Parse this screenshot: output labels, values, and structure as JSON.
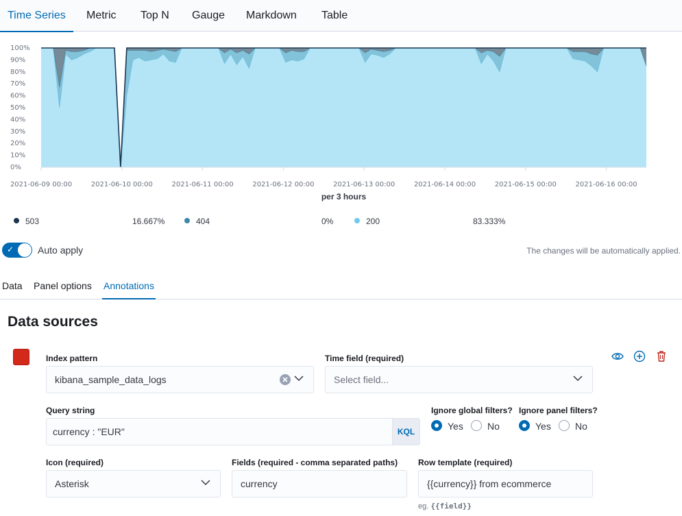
{
  "top_tabs": [
    "Time Series",
    "Metric",
    "Top N",
    "Gauge",
    "Markdown",
    "Table"
  ],
  "chart_data": {
    "type": "area",
    "stacked": true,
    "normalized_percent": true,
    "ylim": [
      0,
      100
    ],
    "y_ticks": [
      "100%",
      "90%",
      "80%",
      "70%",
      "60%",
      "50%",
      "40%",
      "30%",
      "20%",
      "10%",
      "0%"
    ],
    "x_ticks": [
      "2021-06-09 00:00",
      "2021-06-10 00:00",
      "2021-06-11 00:00",
      "2021-06-12 00:00",
      "2021-06-13 00:00",
      "2021-06-14 00:00",
      "2021-06-15 00:00",
      "2021-06-16 00:00"
    ],
    "xlabel": "per 3 hours",
    "x": [
      0,
      1,
      2,
      3,
      4,
      5,
      6,
      7,
      8,
      9,
      10,
      11,
      12,
      13,
      14,
      15,
      16,
      17,
      18,
      19,
      20,
      21,
      22,
      23,
      24,
      25,
      26,
      27,
      28,
      29,
      30,
      31,
      32,
      33,
      34,
      35,
      36,
      37,
      38,
      39,
      40,
      41,
      42,
      43,
      44,
      45,
      46,
      47,
      48,
      49,
      50,
      51,
      52,
      53,
      54,
      55,
      56,
      57,
      58,
      59,
      60,
      61,
      62,
      63,
      64,
      65,
      66,
      67,
      68,
      69,
      70,
      71,
      72,
      73,
      74,
      75,
      76,
      77,
      78,
      79,
      80,
      81,
      82,
      83,
      84,
      85,
      86,
      87,
      88,
      89,
      90,
      91,
      92,
      93,
      94,
      95,
      96,
      97,
      98,
      99
    ],
    "series": [
      {
        "name": "200",
        "color": "#b3e5f7",
        "values": [
          100,
          100,
          100,
          50,
          95,
          90,
          92,
          95,
          97,
          100,
          100,
          100,
          100,
          0,
          60,
          90,
          92,
          89,
          90,
          91,
          95,
          89,
          88,
          100,
          100,
          100,
          100,
          100,
          100,
          100,
          87,
          95,
          86,
          93,
          83,
          100,
          100,
          100,
          100,
          100,
          88,
          90,
          89,
          91,
          100,
          100,
          100,
          100,
          100,
          100,
          100,
          100,
          100,
          88,
          95,
          94,
          92,
          95,
          100,
          100,
          100,
          100,
          100,
          100,
          100,
          100,
          100,
          100,
          100,
          100,
          100,
          100,
          87,
          95,
          89,
          80,
          100,
          100,
          100,
          100,
          100,
          100,
          100,
          100,
          100,
          100,
          100,
          91,
          90,
          89,
          85,
          80,
          100,
          100,
          100,
          100,
          100,
          100,
          100,
          85
        ]
      },
      {
        "name": "404",
        "color": "#6db8d4",
        "values": [
          0,
          0,
          0,
          17,
          3,
          7,
          5,
          3,
          3,
          0,
          0,
          0,
          0,
          0,
          38,
          8,
          6,
          9,
          7,
          7,
          4,
          9,
          9,
          0,
          0,
          0,
          0,
          0,
          0,
          0,
          9,
          4,
          10,
          5,
          12,
          0,
          0,
          0,
          0,
          0,
          8,
          8,
          8,
          6,
          0,
          0,
          0,
          0,
          0,
          0,
          0,
          0,
          0,
          8,
          4,
          4,
          5,
          3,
          0,
          0,
          0,
          0,
          0,
          0,
          0,
          0,
          0,
          0,
          0,
          0,
          0,
          0,
          9,
          3,
          8,
          13,
          0,
          0,
          0,
          0,
          0,
          0,
          0,
          0,
          0,
          0,
          0,
          6,
          7,
          8,
          10,
          14,
          0,
          0,
          0,
          0,
          0,
          0,
          0,
          0
        ]
      },
      {
        "name": "503",
        "color": "#5e7685",
        "values": [
          0,
          0,
          0,
          33,
          2,
          3,
          3,
          2,
          0,
          0,
          0,
          0,
          0,
          0,
          2,
          2,
          2,
          2,
          3,
          2,
          1,
          2,
          3,
          0,
          0,
          0,
          0,
          0,
          0,
          0,
          4,
          1,
          4,
          2,
          5,
          0,
          0,
          0,
          0,
          0,
          4,
          2,
          3,
          3,
          0,
          0,
          0,
          0,
          0,
          0,
          0,
          0,
          0,
          4,
          1,
          2,
          3,
          2,
          0,
          0,
          0,
          0,
          0,
          0,
          0,
          0,
          0,
          0,
          0,
          0,
          0,
          0,
          4,
          2,
          3,
          7,
          0,
          0,
          0,
          0,
          0,
          0,
          0,
          0,
          0,
          0,
          0,
          3,
          3,
          3,
          5,
          6,
          0,
          0,
          0,
          0,
          0,
          0,
          0,
          15
        ]
      }
    ]
  },
  "legend": [
    {
      "label": "503",
      "value": "16.667%",
      "color": "#1b3651"
    },
    {
      "label": "404",
      "value": "0%",
      "color": "#3d87a8"
    },
    {
      "label": "200",
      "value": "83.333%",
      "color": "#6fc9f0"
    }
  ],
  "auto_apply": {
    "label": "Auto apply",
    "message": "The changes will be automatically applied.",
    "enabled": true
  },
  "sub_tabs": [
    "Data",
    "Panel options",
    "Annotations"
  ],
  "section_title": "Data sources",
  "annotation": {
    "color": "#d2291b",
    "index_pattern": {
      "label": "Index pattern",
      "value": "kibana_sample_data_logs"
    },
    "time_field": {
      "label": "Time field (required)",
      "placeholder": "Select field..."
    },
    "query_string": {
      "label": "Query string",
      "value": "currency : \"EUR\"",
      "language": "KQL"
    },
    "ignore_global": {
      "label": "Ignore global filters?",
      "yes": "Yes",
      "no": "No",
      "value": "Yes"
    },
    "ignore_panel": {
      "label": "Ignore panel filters?",
      "yes": "Yes",
      "no": "No",
      "value": "Yes"
    },
    "icon": {
      "label": "Icon (required)",
      "value": "Asterisk"
    },
    "fields": {
      "label": "Fields (required - comma separated paths)",
      "value": "currency"
    },
    "row_template": {
      "label": "Row template (required)",
      "value": "{{currency}} from ecommerce",
      "hint_prefix": "eg.",
      "hint_code": "{{field}}"
    }
  }
}
